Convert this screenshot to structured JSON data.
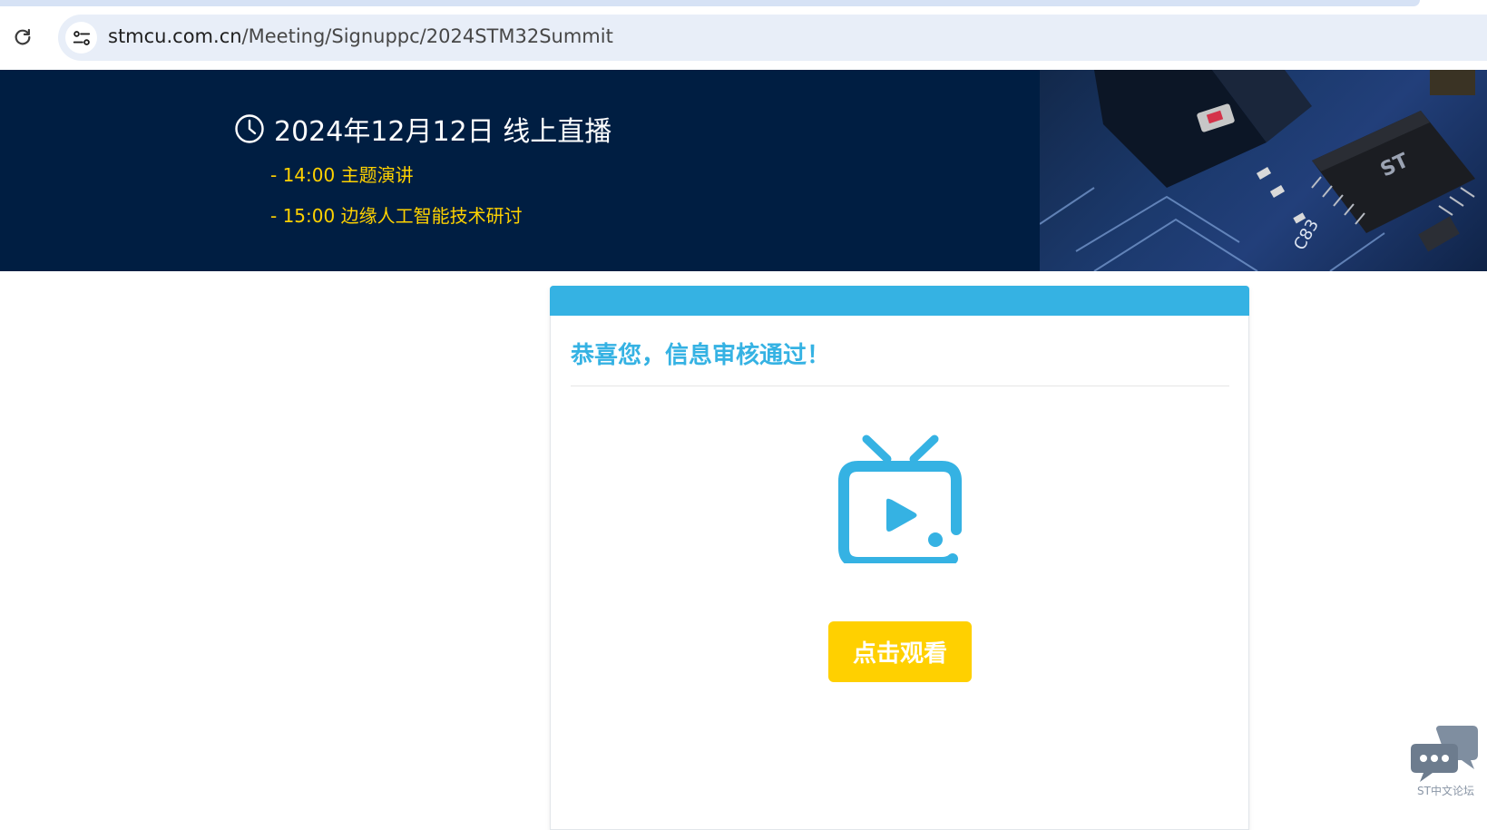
{
  "browser": {
    "url_host": "stmcu.com.cn",
    "url_path": "/Meeting/Signuppc/2024STM32Summit",
    "icons": {
      "reload": "reload-icon",
      "site_info": "tune-icon"
    }
  },
  "banner": {
    "headline": "2024年12月12日 线上直播",
    "agenda": [
      "- 14:00 主题演讲",
      "- 15:00 边缘人工智能技术研讨"
    ],
    "colors": {
      "background": "#001e42",
      "headline": "#ffffff",
      "agenda": "#ffd200"
    },
    "icons": {
      "clock": "clock-icon",
      "photo": "circuit-board-photo"
    }
  },
  "card": {
    "title": "恭喜您，信息审核通过！",
    "watch_button": "点击观看",
    "colors": {
      "accent": "#35b2e3",
      "button": "#ffd000"
    },
    "icons": {
      "tv": "tv-play-icon"
    }
  },
  "forum_widget": {
    "label": "ST中文论坛",
    "icons": {
      "chat": "chat-bubbles-icon"
    }
  }
}
